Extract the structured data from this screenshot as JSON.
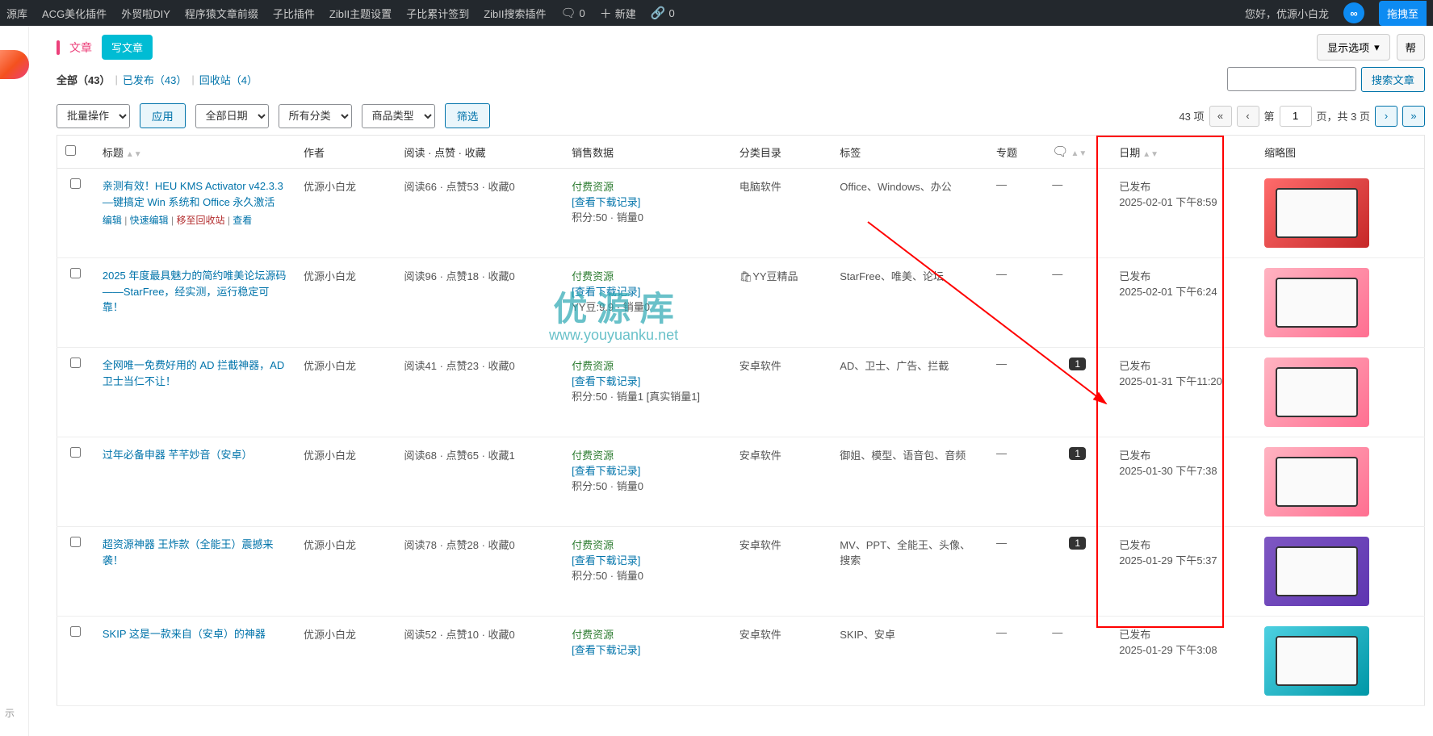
{
  "adminbar": {
    "items": [
      "源库",
      "ACG美化插件",
      "外贸啦DIY",
      "程序猿文章前缀",
      "子比插件",
      "ZibII主题设置",
      "子比累计签到",
      "ZibII搜索插件"
    ],
    "comments": "0",
    "new": "新建",
    "link_count": "0",
    "greeting": "您好，优源小白龙",
    "dragto": "拖拽至"
  },
  "leftnav": {
    "show": "示"
  },
  "page": {
    "title": "文章",
    "write": "写文章",
    "display_options": "显示选项",
    "help": "帮",
    "views": {
      "all_label": "全部",
      "all_count": "（43）",
      "pub_label": "已发布",
      "pub_count": "（43）",
      "trash_label": "回收站",
      "trash_count": "（4）"
    },
    "search_btn": "搜索文章",
    "bulk_placeholder": "批量操作",
    "apply": "应用",
    "all_dates": "全部日期",
    "all_cats": "所有分类",
    "goods_type": "商品类型",
    "filter": "筛选",
    "total_items": "43 项",
    "page_label_pre": "第",
    "page_label_post": "页，共 3 页",
    "page_current": "1"
  },
  "columns": {
    "title": "标题",
    "author": "作者",
    "rlf": "阅读 · 点赞 · 收藏",
    "sale": "销售数据",
    "cat": "分类目录",
    "tag": "标签",
    "topic": "专题",
    "date": "日期",
    "thumb": "缩略图"
  },
  "ra": {
    "edit": "编辑",
    "quick": "快速编辑",
    "trash": "移至回收站",
    "view": "查看"
  },
  "rows": [
    {
      "title": "亲测有效！HEU KMS Activator v42.3.3 —键搞定 Win 系统和 Office 永久激活",
      "author": "优源小白龙",
      "rlf": "阅读66 · 点赞53 · 收藏0",
      "sale_l1": "付费资源",
      "sale_l2": "[查看下载记录]",
      "sale_l3": "积分:50 · 销量0",
      "cat": "电脑软件",
      "tag": "Office、Windows、办公",
      "topic": "—",
      "cmt": "—",
      "date_l1": "已发布",
      "date_l2": "2025-02-01 下午8:59",
      "thumb": "red",
      "show_actions": true
    },
    {
      "title": "2025 年度最具魅力的简约唯美论坛源码 ——StarFree，经实测，运行稳定可靠！",
      "author": "优源小白龙",
      "rlf": "阅读96 · 点赞18 · 收藏0",
      "sale_l1": "付费资源",
      "sale_l2": "[查看下载记录]",
      "sale_l3": "YY豆:9.9 · 销量0",
      "cat": "🛍YY豆精品",
      "tag": "StarFree、唯美、论坛",
      "topic": "—",
      "cmt": "—",
      "date_l1": "已发布",
      "date_l2": "2025-02-01 下午6:24",
      "thumb": "pink"
    },
    {
      "title": "全网唯一免费好用的 AD 拦截神器，AD 卫士当仁不让！",
      "author": "优源小白龙",
      "rlf": "阅读41 · 点赞23 · 收藏0",
      "sale_l1": "付费资源",
      "sale_l2": "[查看下载记录]",
      "sale_l3": "积分:50 · 销量1 [真实销量1]",
      "cat": "安卓软件",
      "tag": "AD、卫士、广告、拦截",
      "topic": "—",
      "cmt": "1",
      "date_l1": "已发布",
      "date_l2": "2025-01-31 下午11:20",
      "thumb": "pink"
    },
    {
      "title": "过年必备申器 芊芊妙音（安卓）",
      "author": "优源小白龙",
      "rlf": "阅读68 · 点赞65 · 收藏1",
      "sale_l1": "付费资源",
      "sale_l2": "[查看下载记录]",
      "sale_l3": "积分:50 · 销量0",
      "cat": "安卓软件",
      "tag": "御姐、模型、语音包、音频",
      "topic": "—",
      "cmt": "1",
      "date_l1": "已发布",
      "date_l2": "2025-01-30 下午7:38",
      "thumb": "pink"
    },
    {
      "title": "超资源神器 王炸款（全能王）震撼来袭！",
      "author": "优源小白龙",
      "rlf": "阅读78 · 点赞28 · 收藏0",
      "sale_l1": "付费资源",
      "sale_l2": "[查看下载记录]",
      "sale_l3": "积分:50 · 销量0",
      "cat": "安卓软件",
      "tag": "MV、PPT、全能王、头像、搜索",
      "topic": "—",
      "cmt": "1",
      "date_l1": "已发布",
      "date_l2": "2025-01-29 下午5:37",
      "thumb": "purple"
    },
    {
      "title": "SKIP 这是一款来自（安卓）的神器",
      "author": "优源小白龙",
      "rlf": "阅读52 · 点赞10 · 收藏0",
      "sale_l1": "付费资源",
      "sale_l2": "[查看下载记录]",
      "sale_l3": "",
      "cat": "安卓软件",
      "tag": "SKIP、安卓",
      "topic": "—",
      "cmt": "—",
      "date_l1": "已发布",
      "date_l2": "2025-01-29 下午3:08",
      "thumb": "cyan"
    }
  ],
  "watermark": {
    "big": "优 源 库",
    "small": "www.youyuanku.net"
  }
}
